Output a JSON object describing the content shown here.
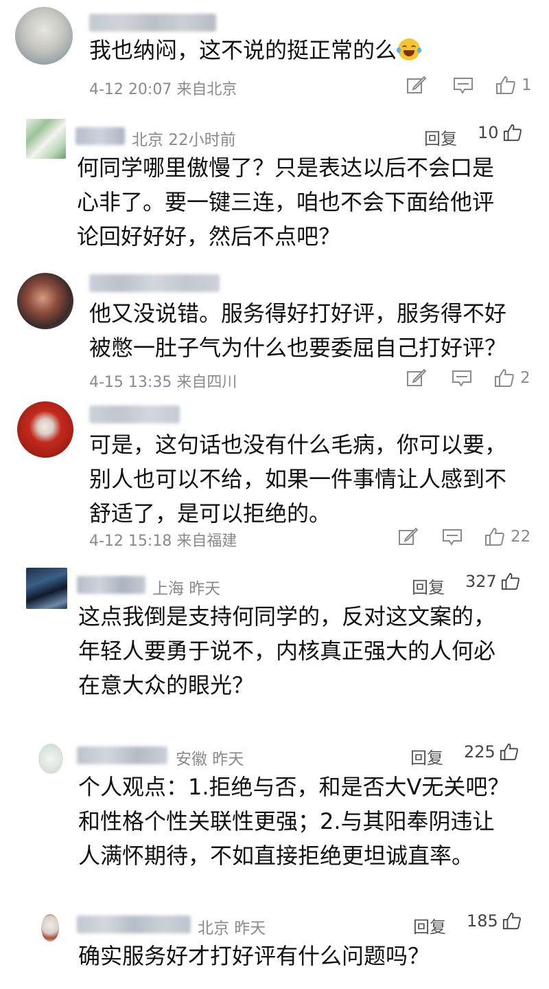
{
  "comments": [
    {
      "text_lines": [
        "我也纳闷，这不说的挺正常的么"
      ],
      "has_emoji": true,
      "footer_time": "4-12 20:07 来自北京",
      "like_count": "1"
    },
    {
      "meta": "北京 22小时前",
      "reply_label": "回复",
      "like_count": "10",
      "text_lines": [
        "何同学哪里傲慢了？只是表达以后不会口是",
        "心非了。要一键三连，咱也不会下面给他评",
        "论回好好好，然后不点吧？"
      ]
    },
    {
      "text_lines": [
        "他又没说错。服务得好打好评，服务得不好",
        "被憋一肚子气为什么也要委屈自己打好评？"
      ],
      "footer_time": "4-15 13:35 来自四川",
      "like_count": "2"
    },
    {
      "text_lines": [
        "可是，这句话也没有什么毛病，你可以要，",
        "别人也可以不给，如果一件事情让人感到不",
        "舒适了，是可以拒绝的。"
      ],
      "footer_time": "4-12 15:18 来自福建",
      "like_count": "22"
    },
    {
      "meta": "上海 昨天",
      "reply_label": "回复",
      "like_count": "327",
      "text_lines": [
        "这点我倒是支持何同学的，反对这文案的，",
        "年轻人要勇于说不，内核真正强大的人何必",
        "在意大众的眼光？"
      ]
    },
    {
      "meta": "安徽 昨天",
      "reply_label": "回复",
      "like_count": "225",
      "text_lines": [
        "个人观点：1.拒绝与否，和是否大V无关吧？",
        "和性格个性关联性更强；2.与其阳奉阴违让",
        "人满怀期待，不如直接拒绝更坦诚直率。"
      ]
    },
    {
      "meta": "北京 昨天",
      "reply_label": "回复",
      "like_count": "185",
      "text_lines": [
        "确实服务好才打好评有什么问题吗？"
      ]
    }
  ],
  "icons": {
    "edit": "edit-icon",
    "comment": "comment-icon",
    "like": "thumbs-up-icon"
  }
}
